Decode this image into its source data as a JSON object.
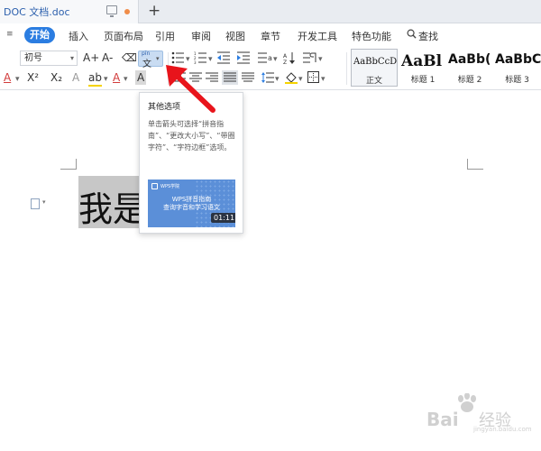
{
  "title_tab": {
    "label": "DOC 文档.doc",
    "new_tab": "+"
  },
  "menu": {
    "chevron": "≡",
    "tabs": [
      "开始",
      "插入",
      "页面布局",
      "引用",
      "审阅",
      "视图",
      "章节",
      "开发工具",
      "特色功能"
    ],
    "search_label": "查找"
  },
  "toolbar": {
    "font_size_value": "初号",
    "grow_font": "A+",
    "shrink_font": "A-",
    "clear_format": "⌫",
    "pinyin_top": "pīn",
    "pinyin_char": "文",
    "row2_font_color": "A",
    "row2_superscript": "X²",
    "row2_subscript": "X₂",
    "row2_outline": "A",
    "row2_char_shading": "A"
  },
  "styles": [
    {
      "sample": "AaBbCcDd",
      "name": "正文"
    },
    {
      "sample": "AaBl",
      "name": "标题 1"
    },
    {
      "sample": "AaBb(",
      "name": "标题 2"
    },
    {
      "sample": "AaBbC",
      "name": "标题 3"
    }
  ],
  "document": {
    "visible_text": "我是"
  },
  "popup": {
    "title": "其他选项",
    "description": "单击箭头可选择“拼音指南”、“更改大小写”、“带圈字符”、“字符边框”选项。",
    "video_logo": "WPS学院",
    "video_line1": "WPS拼音指南",
    "video_line2": "查询字音和学习语文",
    "video_duration": "01:11"
  },
  "watermark": {
    "brand": "Bai",
    "jingyan": "经验",
    "url": "jingyan.baidu.com"
  },
  "colors": {
    "accent": "#2b7de1",
    "arrow": "#e8141b",
    "selection": "#c7c7c7"
  }
}
